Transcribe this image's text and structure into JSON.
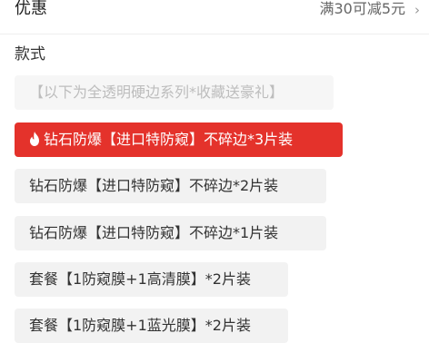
{
  "promo": {
    "label": "优惠",
    "value": "满30可减5元",
    "chevron": "›"
  },
  "style_section": {
    "title": "款式",
    "options": [
      {
        "label": "【以下为全透明硬边系列*收藏送豪礼】",
        "state": "disabled"
      },
      {
        "label": "钻石防爆【进口特防窥】不碎边*3片装",
        "state": "selected",
        "icon": "fire-icon"
      },
      {
        "label": "钻石防爆【进口特防窥】不碎边*2片装",
        "state": "normal"
      },
      {
        "label": "钻石防爆【进口特防窥】不碎边*1片装",
        "state": "normal"
      },
      {
        "label": "套餐【1防窥膜+1高清膜】*2片装",
        "state": "normal"
      },
      {
        "label": "套餐【1防窥膜+1蓝光膜】*2片装",
        "state": "normal"
      }
    ]
  },
  "colors": {
    "selected_bg": "#e4322b",
    "chip_bg": "#f2f2f2",
    "disabled_text": "#bdbdbd"
  }
}
